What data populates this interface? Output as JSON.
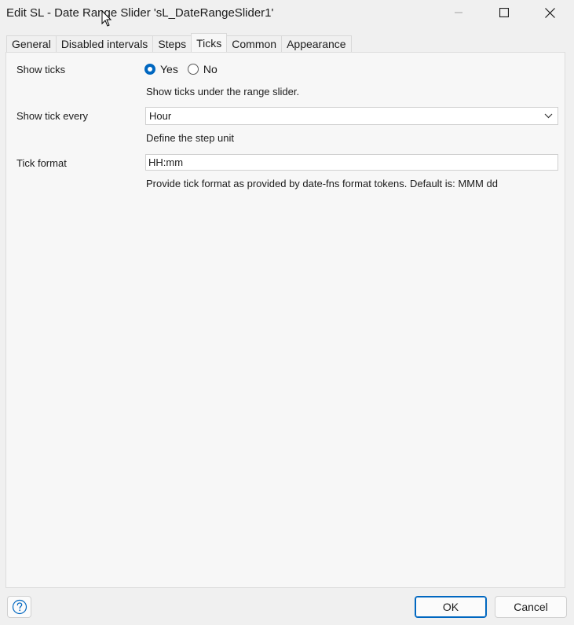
{
  "window": {
    "title": "Edit SL - Date Range Slider 'sL_DateRangeSlider1'",
    "buttons": {
      "minimize": "minimize-icon",
      "maximize": "maximize-icon",
      "close": "close-icon"
    }
  },
  "tabs": [
    {
      "label": "General",
      "active": false
    },
    {
      "label": "Disabled intervals",
      "active": false
    },
    {
      "label": "Steps",
      "active": false
    },
    {
      "label": "Ticks",
      "active": true
    },
    {
      "label": "Common",
      "active": false
    },
    {
      "label": "Appearance",
      "active": false
    }
  ],
  "form": {
    "show_ticks": {
      "label": "Show ticks",
      "options": [
        "Yes",
        "No"
      ],
      "selected": "Yes",
      "hint": "Show ticks under the range slider."
    },
    "show_tick_every": {
      "label": "Show tick every",
      "value": "Hour",
      "hint": "Define the step unit"
    },
    "tick_format": {
      "label": "Tick format",
      "value": "HH:mm",
      "hint": "Provide tick format as provided by date-fns format tokens. Default is: MMM dd"
    }
  },
  "footer": {
    "help_icon": "help-icon",
    "ok_label": "OK",
    "cancel_label": "Cancel"
  },
  "colors": {
    "accent": "#0067c0",
    "panel_bg": "#f7f7f7",
    "window_bg": "#f0f0f0"
  }
}
